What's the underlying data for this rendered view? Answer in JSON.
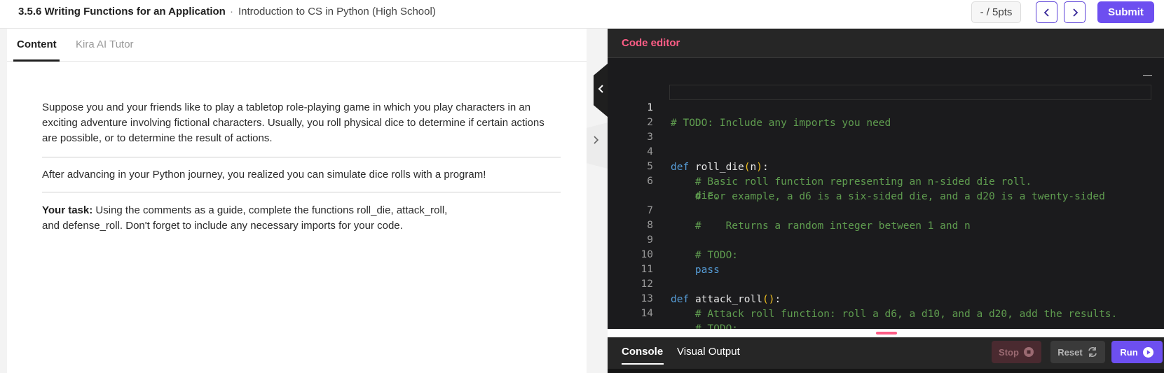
{
  "header": {
    "title": "3.5.6 Writing Functions for an Application",
    "separator": "·",
    "course": "Introduction to CS in Python (High School)",
    "points": "- / 5pts",
    "submit_label": "Submit"
  },
  "left_tabs": {
    "content": "Content",
    "tutor": "Kira AI Tutor"
  },
  "content": {
    "intro": "Suppose you and your friends like to play a tabletop role-playing game in which you play characters in an exciting adventure involving fictional characters. Usually, you roll physical dice to determine if certain actions are possible, or to determine the result of actions.",
    "journey": "After advancing in your Python journey, you realized you can simulate dice rolls with a program!",
    "task_label": "Your task:",
    "task_line1": " Using the comments as a guide, complete the functions roll_die, attack_roll,",
    "task_line2": "and defense_roll. Don't forget to include any necessary imports for your code."
  },
  "editor": {
    "title": "Code editor",
    "lines": {
      "n1": "1",
      "n2": "2",
      "n3": "3",
      "n4": "4",
      "n5": "5",
      "n6": "6",
      "n7": "7",
      "n8": "8",
      "n9": "9",
      "n10": "10",
      "n11": "11",
      "n12": "12",
      "n13": "13",
      "n14": "14",
      "l1": "# TODO: Include any imports you need",
      "l4_kw": "def",
      "l4_name": "roll_die",
      "l4_open": "(",
      "l4_param": "n",
      "l4_close": ")",
      "l4_colon": ":",
      "l5": "    # Basic roll function representing an n-sided die roll.",
      "l6a": "    # For example, a d6 is a six-sided die, and a d20 is a twenty-sided",
      "l6b": "    die.",
      "l7": "    #    Returns a random integer between 1 and n",
      "l9": "    # TODO:",
      "l10": "pass",
      "l12_kw": "def",
      "l12_name": "attack_roll",
      "l12_parens": "()",
      "l12_colon": ":",
      "l13": "    # Attack roll function: roll a d6, a d10, and a d20, add the results.",
      "l14": "    # TODO:"
    }
  },
  "console": {
    "tab_console": "Console",
    "tab_visual": "Visual Output",
    "stop_label": "Stop",
    "reset_label": "Reset",
    "run_label": "Run"
  },
  "colors": {
    "accent": "#6d4ff0",
    "editor_title": "#ff5d86",
    "comment": "#5f9c4f",
    "keyword": "#569cd6",
    "paren": "#f0c020"
  }
}
